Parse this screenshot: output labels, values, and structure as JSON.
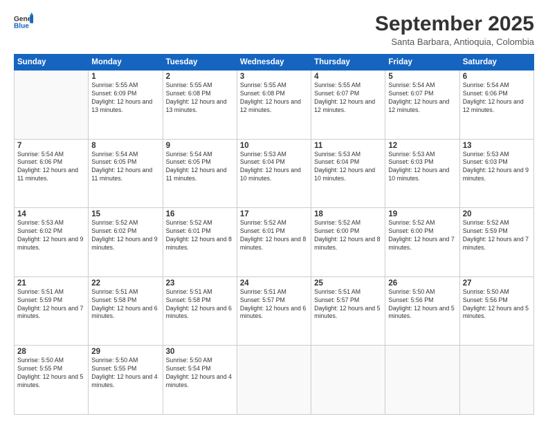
{
  "header": {
    "logo_line1": "General",
    "logo_line2": "Blue",
    "month_title": "September 2025",
    "location": "Santa Barbara, Antioquia, Colombia"
  },
  "days_of_week": [
    "Sunday",
    "Monday",
    "Tuesday",
    "Wednesday",
    "Thursday",
    "Friday",
    "Saturday"
  ],
  "weeks": [
    [
      {
        "day": "",
        "text": ""
      },
      {
        "day": "1",
        "text": "Sunrise: 5:55 AM\nSunset: 6:09 PM\nDaylight: 12 hours\nand 13 minutes."
      },
      {
        "day": "2",
        "text": "Sunrise: 5:55 AM\nSunset: 6:08 PM\nDaylight: 12 hours\nand 13 minutes."
      },
      {
        "day": "3",
        "text": "Sunrise: 5:55 AM\nSunset: 6:08 PM\nDaylight: 12 hours\nand 12 minutes."
      },
      {
        "day": "4",
        "text": "Sunrise: 5:55 AM\nSunset: 6:07 PM\nDaylight: 12 hours\nand 12 minutes."
      },
      {
        "day": "5",
        "text": "Sunrise: 5:54 AM\nSunset: 6:07 PM\nDaylight: 12 hours\nand 12 minutes."
      },
      {
        "day": "6",
        "text": "Sunrise: 5:54 AM\nSunset: 6:06 PM\nDaylight: 12 hours\nand 12 minutes."
      }
    ],
    [
      {
        "day": "7",
        "text": "Sunrise: 5:54 AM\nSunset: 6:06 PM\nDaylight: 12 hours\nand 11 minutes."
      },
      {
        "day": "8",
        "text": "Sunrise: 5:54 AM\nSunset: 6:05 PM\nDaylight: 12 hours\nand 11 minutes."
      },
      {
        "day": "9",
        "text": "Sunrise: 5:54 AM\nSunset: 6:05 PM\nDaylight: 12 hours\nand 11 minutes."
      },
      {
        "day": "10",
        "text": "Sunrise: 5:53 AM\nSunset: 6:04 PM\nDaylight: 12 hours\nand 10 minutes."
      },
      {
        "day": "11",
        "text": "Sunrise: 5:53 AM\nSunset: 6:04 PM\nDaylight: 12 hours\nand 10 minutes."
      },
      {
        "day": "12",
        "text": "Sunrise: 5:53 AM\nSunset: 6:03 PM\nDaylight: 12 hours\nand 10 minutes."
      },
      {
        "day": "13",
        "text": "Sunrise: 5:53 AM\nSunset: 6:03 PM\nDaylight: 12 hours\nand 9 minutes."
      }
    ],
    [
      {
        "day": "14",
        "text": "Sunrise: 5:53 AM\nSunset: 6:02 PM\nDaylight: 12 hours\nand 9 minutes."
      },
      {
        "day": "15",
        "text": "Sunrise: 5:52 AM\nSunset: 6:02 PM\nDaylight: 12 hours\nand 9 minutes."
      },
      {
        "day": "16",
        "text": "Sunrise: 5:52 AM\nSunset: 6:01 PM\nDaylight: 12 hours\nand 8 minutes."
      },
      {
        "day": "17",
        "text": "Sunrise: 5:52 AM\nSunset: 6:01 PM\nDaylight: 12 hours\nand 8 minutes."
      },
      {
        "day": "18",
        "text": "Sunrise: 5:52 AM\nSunset: 6:00 PM\nDaylight: 12 hours\nand 8 minutes."
      },
      {
        "day": "19",
        "text": "Sunrise: 5:52 AM\nSunset: 6:00 PM\nDaylight: 12 hours\nand 7 minutes."
      },
      {
        "day": "20",
        "text": "Sunrise: 5:52 AM\nSunset: 5:59 PM\nDaylight: 12 hours\nand 7 minutes."
      }
    ],
    [
      {
        "day": "21",
        "text": "Sunrise: 5:51 AM\nSunset: 5:59 PM\nDaylight: 12 hours\nand 7 minutes."
      },
      {
        "day": "22",
        "text": "Sunrise: 5:51 AM\nSunset: 5:58 PM\nDaylight: 12 hours\nand 6 minutes."
      },
      {
        "day": "23",
        "text": "Sunrise: 5:51 AM\nSunset: 5:58 PM\nDaylight: 12 hours\nand 6 minutes."
      },
      {
        "day": "24",
        "text": "Sunrise: 5:51 AM\nSunset: 5:57 PM\nDaylight: 12 hours\nand 6 minutes."
      },
      {
        "day": "25",
        "text": "Sunrise: 5:51 AM\nSunset: 5:57 PM\nDaylight: 12 hours\nand 5 minutes."
      },
      {
        "day": "26",
        "text": "Sunrise: 5:50 AM\nSunset: 5:56 PM\nDaylight: 12 hours\nand 5 minutes."
      },
      {
        "day": "27",
        "text": "Sunrise: 5:50 AM\nSunset: 5:56 PM\nDaylight: 12 hours\nand 5 minutes."
      }
    ],
    [
      {
        "day": "28",
        "text": "Sunrise: 5:50 AM\nSunset: 5:55 PM\nDaylight: 12 hours\nand 5 minutes."
      },
      {
        "day": "29",
        "text": "Sunrise: 5:50 AM\nSunset: 5:55 PM\nDaylight: 12 hours\nand 4 minutes."
      },
      {
        "day": "30",
        "text": "Sunrise: 5:50 AM\nSunset: 5:54 PM\nDaylight: 12 hours\nand 4 minutes."
      },
      {
        "day": "",
        "text": ""
      },
      {
        "day": "",
        "text": ""
      },
      {
        "day": "",
        "text": ""
      },
      {
        "day": "",
        "text": ""
      }
    ]
  ]
}
